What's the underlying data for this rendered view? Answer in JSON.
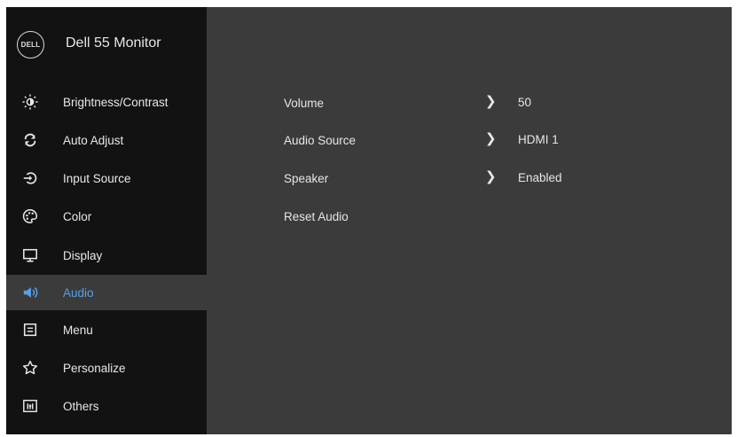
{
  "header": {
    "logo_text": "DELL",
    "title": "Dell 55 Monitor"
  },
  "sidebar": {
    "items": [
      {
        "label": "Brightness/Contrast",
        "icon": "brightness-icon"
      },
      {
        "label": "Auto Adjust",
        "icon": "auto-adjust-icon"
      },
      {
        "label": "Input Source",
        "icon": "input-source-icon"
      },
      {
        "label": "Color",
        "icon": "color-palette-icon"
      },
      {
        "label": "Display",
        "icon": "display-icon"
      },
      {
        "label": "Audio",
        "icon": "speaker-icon",
        "selected": true
      },
      {
        "label": "Menu",
        "icon": "menu-icon"
      },
      {
        "label": "Personalize",
        "icon": "star-icon"
      },
      {
        "label": "Others",
        "icon": "others-icon"
      }
    ]
  },
  "main": {
    "rows": [
      {
        "label": "Volume",
        "value": "50"
      },
      {
        "label": "Audio Source",
        "value": "HDMI 1"
      },
      {
        "label": "Speaker",
        "value": "Enabled"
      },
      {
        "label": "Reset Audio",
        "value": ""
      }
    ]
  },
  "colors": {
    "panel": "#3b3b3b",
    "sidebar": "#121212",
    "accent": "#5aa0e6"
  }
}
